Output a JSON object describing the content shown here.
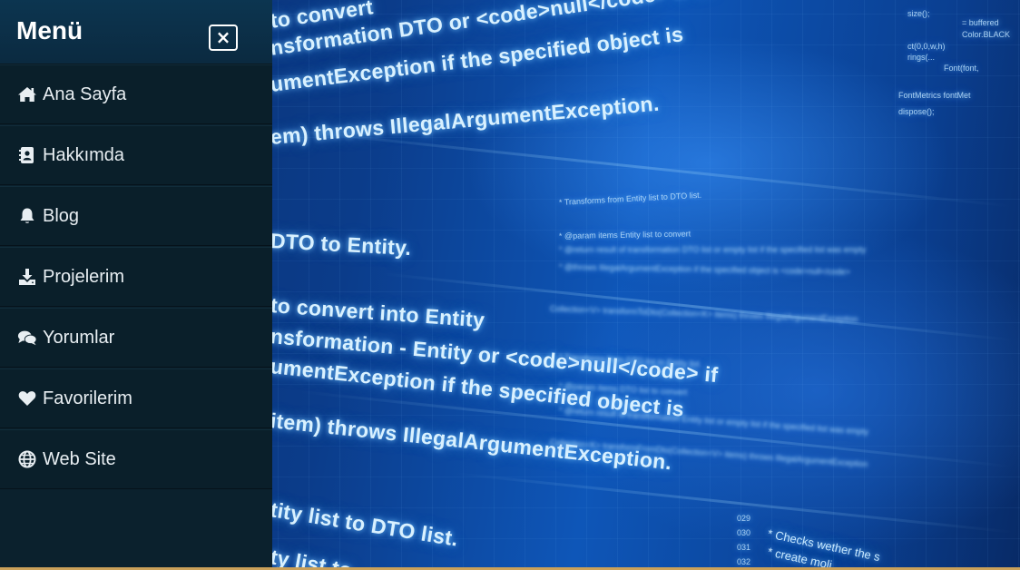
{
  "menu": {
    "title": "Menü",
    "close_label": "×",
    "items": [
      {
        "label": "Ana Sayfa",
        "icon": "home-icon"
      },
      {
        "label": "Hakkımda",
        "icon": "address-book-icon"
      },
      {
        "label": "Blog",
        "icon": "bell-icon"
      },
      {
        "label": "Projelerim",
        "icon": "download-icon"
      },
      {
        "label": "Yorumlar",
        "icon": "comments-icon"
      },
      {
        "label": "Favorilerim",
        "icon": "heart-icon"
      },
      {
        "label": "Web Site",
        "icon": "globe-icon"
      }
    ]
  },
  "background": {
    "code_lines": [
      "to convert",
      "nsformation DTO or <code>null</code> if th",
      "umentException if the specified object is",
      "em) throws IllegalArgumentException.",
      "DTO to Entity.",
      "to convert into Entity",
      "nsformation - Entity or <code>null</code> if",
      "umentException if the specified object is",
      "item) throws IllegalArgumentException.",
      "tity list to DTO list.",
      "ty list to"
    ],
    "small_lines": [
      "* Transforms from Entity list to DTO list.",
      "* @param items Entity list to convert",
      "* @return result of transformation DTO list or empty list if the specified list was empty",
      "* @throws IllegalArgumentException if the specified object is <code>null</code>",
      "Collection<V> transformToDto(Collection<K> items) throws IllegalArgumentException",
      "* Transforms from DTO list to Entity list.",
      "* @param items DTO list to convert",
      "* @return result of transformation Entity list or empty list if the specified list was empty",
      "Collection<K> transformFromDto(Collection<V> items) throws IllegalArgumentException",
      "* Checks wether the s",
      "* create moli"
    ],
    "line_numbers": [
      "029",
      "030",
      "031",
      "032"
    ],
    "corner_code": [
      "size();",
      "= buffered",
      "Color.BLACK",
      "ct(0,0,w,h)",
      "rings(...",
      "Font(font,",
      "FontMetrics fontMet",
      "dispose();"
    ]
  }
}
